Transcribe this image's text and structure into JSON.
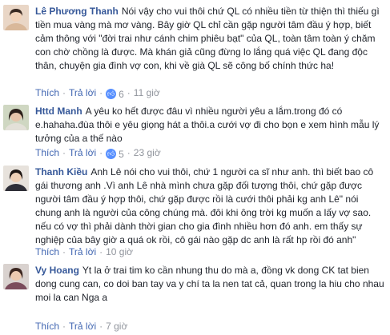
{
  "ui": {
    "like_label": "Thích",
    "reply_label": "Trả lời",
    "separator": "·"
  },
  "comments": [
    {
      "author": "Lê Phương Thanh",
      "text": "Nói vậy cho vui thôi chứ QL có nhiều tiền từ thiện thì thiếu gì tiền mua vàng mà mơ vàng. Bây giờ QL chỉ cần gặp người tâm đầu ý hợp, biết cảm thông với \"đời trai như cánh chim phiêu bạt\" của QL, toàn tâm toàn ý chăm con chờ chồng là được. Mà khán giả cũng đừng lo lắng quá việc QL đang độc thân, chuyện gia đình vợ con, khi về già QL sẽ công bố chính thức ha!",
      "reactions": "6",
      "time": "11 giờ"
    },
    {
      "author": "Httd Manh",
      "text": "A yêu ko hết được đâu vì nhiều người yêu a lắm.trong đó có e.hahaha.đùa thôi e yêu giọng hát a thôi.a cưới vợ đi cho bọn e xem hình mẫu lý tưởng của a thế nào",
      "reactions": "5",
      "time": "23 giờ"
    },
    {
      "author": "Thanh Kiều",
      "text": "Anh Lê nói cho vui thôi, chứ 1 người ca sĩ như anh. thì biết bao cô gái thương anh .Vì anh Lê nhà mình chưa gặp đối tượng thôi, chứ gặp được người tâm đầu ý hợp thôi, chứ gặp được rồi là cưới thôi phải kg anh Lê\" nói chung anh là người của công chúng mà. đôi khi ông trời kg muốn a lấy vợ sao. nếu có vợ thì phải dành thời gian cho gia đình nhiều hơn đó anh. em thấy sự nghiệp của bây giờ a quá ok rồi, cô gái nào gặp dc anh là rất hp rồi đó anh\"",
      "reactions": "",
      "time": "10 giờ"
    },
    {
      "author": "Vy Hoang",
      "text": "Yt la ở trai tim ko cần nhung thu do mà a, đồng vk dong CK tat bien dong cung can, co doi ban tay va y chí ta la nen tat cả, quan trong la hiu cho nhau moi la can Nga a",
      "reactions": "",
      "time": "7 giờ"
    }
  ]
}
